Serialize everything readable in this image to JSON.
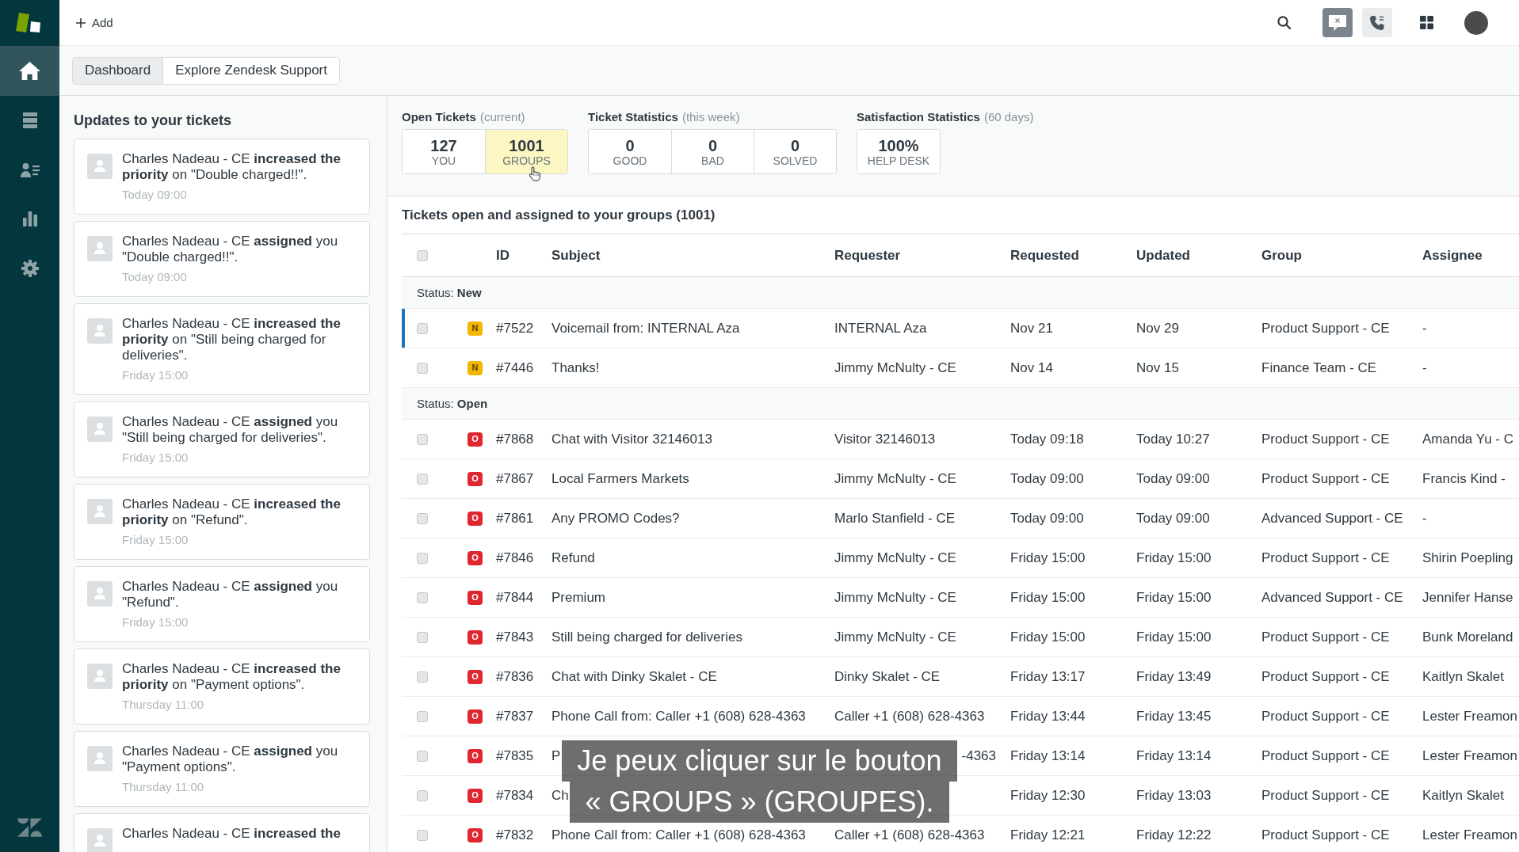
{
  "nav": {
    "items": [
      {
        "selected": true
      },
      {
        "selected": false
      },
      {
        "selected": false
      },
      {
        "selected": false
      },
      {
        "selected": false
      }
    ]
  },
  "topbar": {
    "add_label": "Add",
    "status_buttons": [
      {
        "kind": "chat",
        "active": true
      },
      {
        "kind": "phone",
        "active": false
      }
    ]
  },
  "tabs": [
    {
      "label": "Dashboard",
      "selected": true
    },
    {
      "label": "Explore Zendesk Support",
      "selected": false
    }
  ],
  "updates": {
    "title": "Updates to your tickets",
    "items": [
      {
        "text": "Charles Nadeau - CE **increased the priority** on \"Double charged!!\".",
        "time": "Today 09:00"
      },
      {
        "text": "Charles Nadeau - CE **assigned** you \"Double charged!!\".",
        "time": "Today 09:00"
      },
      {
        "text": "Charles Nadeau - CE **increased the priority** on \"Still being charged for deliveries\".",
        "time": "Friday 15:00"
      },
      {
        "text": "Charles Nadeau - CE **assigned** you \"Still being charged for deliveries\".",
        "time": "Friday 15:00"
      },
      {
        "text": "Charles Nadeau - CE **increased the priority** on \"Refund\".",
        "time": "Friday 15:00"
      },
      {
        "text": "Charles Nadeau - CE **assigned** you \"Refund\".",
        "time": "Friday 15:00"
      },
      {
        "text": "Charles Nadeau - CE **increased the priority** on \"Payment options\".",
        "time": "Thursday 11:00"
      },
      {
        "text": "Charles Nadeau - CE **assigned** you \"Payment options\".",
        "time": "Thursday 11:00"
      },
      {
        "text": "Charles Nadeau - CE **increased the**"
      }
    ]
  },
  "stats": [
    {
      "title": "Open Tickets",
      "period": "(current)",
      "cells": [
        {
          "value": "127",
          "label": "YOU",
          "selected": false
        },
        {
          "value": "1001",
          "label": "GROUPS",
          "selected": true
        }
      ]
    },
    {
      "title": "Ticket Statistics",
      "period": "(this week)",
      "cells": [
        {
          "value": "0",
          "label": "GOOD",
          "selected": false
        },
        {
          "value": "0",
          "label": "BAD",
          "selected": false
        },
        {
          "value": "0",
          "label": "SOLVED",
          "selected": false
        }
      ]
    },
    {
      "title": "Satisfaction Statistics",
      "period": "(60 days)",
      "cells": [
        {
          "value": "100%",
          "label": "HELP DESK",
          "selected": false
        }
      ]
    }
  ],
  "tickets": {
    "title": "Tickets open and assigned to your groups (1001)",
    "header_checked": false,
    "columns": [
      "ID",
      "Subject",
      "Requester",
      "Requested",
      "Updated",
      "Group",
      "Assignee"
    ],
    "groups": [
      {
        "label": "Status: **New**",
        "rows": [
          {
            "kind": "plain",
            "selected": true,
            "checked": false,
            "status": "N",
            "color": "#f2b705",
            "id": "#7522",
            "subject": "Voicemail from: INTERNAL Aza",
            "requester": "INTERNAL Aza",
            "requested": "Nov 21",
            "updated": "Nov 29",
            "group": "Product Support - CE",
            "assignee": "-"
          },
          {
            "kind": "plain",
            "selected": false,
            "checked": false,
            "status": "N",
            "color": "#f2b705",
            "id": "#7446",
            "subject": "Thanks!",
            "requester": "Jimmy McNulty - CE",
            "requested": "Nov 14",
            "updated": "Nov 15",
            "group": "Finance Team - CE",
            "assignee": "-"
          }
        ]
      },
      {
        "label": "Status: **Open**",
        "rows": [
          {
            "kind": "plain",
            "selected": false,
            "checked": false,
            "status": "O",
            "color": "#e0262f",
            "id": "#7868",
            "subject": "Chat with Visitor 32146013",
            "requester": "Visitor 32146013",
            "requested": "Today 09:18",
            "updated": "Today 10:27",
            "group": "Product Support - CE",
            "assignee": "Amanda Yu - C"
          },
          {
            "kind": "plain",
            "selected": false,
            "checked": false,
            "status": "O",
            "color": "#e0262f",
            "id": "#7867",
            "subject": "Local Farmers Markets",
            "requester": "Jimmy McNulty - CE",
            "requested": "Today 09:00",
            "updated": "Today 09:00",
            "group": "Product Support - CE",
            "assignee": "Francis Kind -"
          },
          {
            "kind": "plain",
            "selected": false,
            "checked": false,
            "status": "O",
            "color": "#e0262f",
            "id": "#7861",
            "subject": "Any PROMO Codes?",
            "requester": "Marlo Stanfield - CE",
            "requested": "Today 09:00",
            "updated": "Today 09:00",
            "group": "Advanced Support - CE",
            "assignee": "-"
          },
          {
            "kind": "plain",
            "selected": false,
            "checked": false,
            "status": "O",
            "color": "#e0262f",
            "id": "#7846",
            "subject": "Refund",
            "requester": "Jimmy McNulty - CE",
            "requested": "Friday 15:00",
            "updated": "Friday 15:00",
            "group": "Product Support - CE",
            "assignee": "Shirin Poepling"
          },
          {
            "kind": "plain",
            "selected": false,
            "checked": false,
            "status": "O",
            "color": "#e0262f",
            "id": "#7844",
            "subject": "Premium",
            "requester": "Jimmy McNulty - CE",
            "requested": "Friday 15:00",
            "updated": "Friday 15:00",
            "group": "Advanced Support - CE",
            "assignee": "Jennifer Hanse"
          },
          {
            "kind": "plain",
            "selected": false,
            "checked": false,
            "status": "O",
            "color": "#e0262f",
            "id": "#7843",
            "subject": "Still being charged for deliveries",
            "requester": "Jimmy McNulty - CE",
            "requested": "Friday 15:00",
            "updated": "Friday 15:00",
            "group": "Product Support - CE",
            "assignee": "Bunk Moreland"
          },
          {
            "kind": "plain",
            "selected": false,
            "checked": false,
            "status": "O",
            "color": "#e0262f",
            "id": "#7836",
            "subject": "Chat with Dinky Skalet - CE",
            "requester": "Dinky Skalet - CE",
            "requested": "Friday 13:17",
            "updated": "Friday 13:49",
            "group": "Product Support - CE",
            "assignee": "Kaitlyn Skalet"
          },
          {
            "kind": "plain",
            "selected": false,
            "checked": false,
            "status": "O",
            "color": "#e0262f",
            "id": "#7837",
            "subject": "Phone Call from: Caller +1 (608) 628-4363",
            "requester": "Caller +1 (608) 628-4363",
            "requested": "Friday 13:44",
            "updated": "Friday 13:45",
            "group": "Product Support - CE",
            "assignee": "Lester Freamon"
          },
          {
            "kind": "covered",
            "selected": false,
            "checked": false,
            "status": "O",
            "color": "#e0262f",
            "id": "#7835",
            "subject": "P",
            "requester": "-4363",
            "requested": "Friday 13:14",
            "updated": "Friday 13:14",
            "group": "Product Support - CE",
            "assignee": "Lester Freamon"
          },
          {
            "kind": "covered",
            "selected": false,
            "checked": false,
            "status": "O",
            "color": "#e0262f",
            "id": "#7834",
            "subject": "Ch",
            "requested": "Friday 12:30",
            "updated": "Friday 13:03",
            "group": "Product Support - CE",
            "assignee": "Kaitlyn Skalet"
          },
          {
            "kind": "plain",
            "selected": false,
            "checked": false,
            "status": "O",
            "color": "#e0262f",
            "id": "#7832",
            "subject": "Phone Call from: Caller +1 (608) 628-4363",
            "requester": "Caller +1 (608) 628-4363",
            "requested": "Friday 12:21",
            "updated": "Friday 12:22",
            "group": "Product Support - CE",
            "assignee": "Lester Freamon"
          }
        ]
      }
    ]
  },
  "subtitle": {
    "lines": [
      "Je peux cliquer sur le bouton",
      "« GROUPS » (GROUPES)."
    ]
  }
}
